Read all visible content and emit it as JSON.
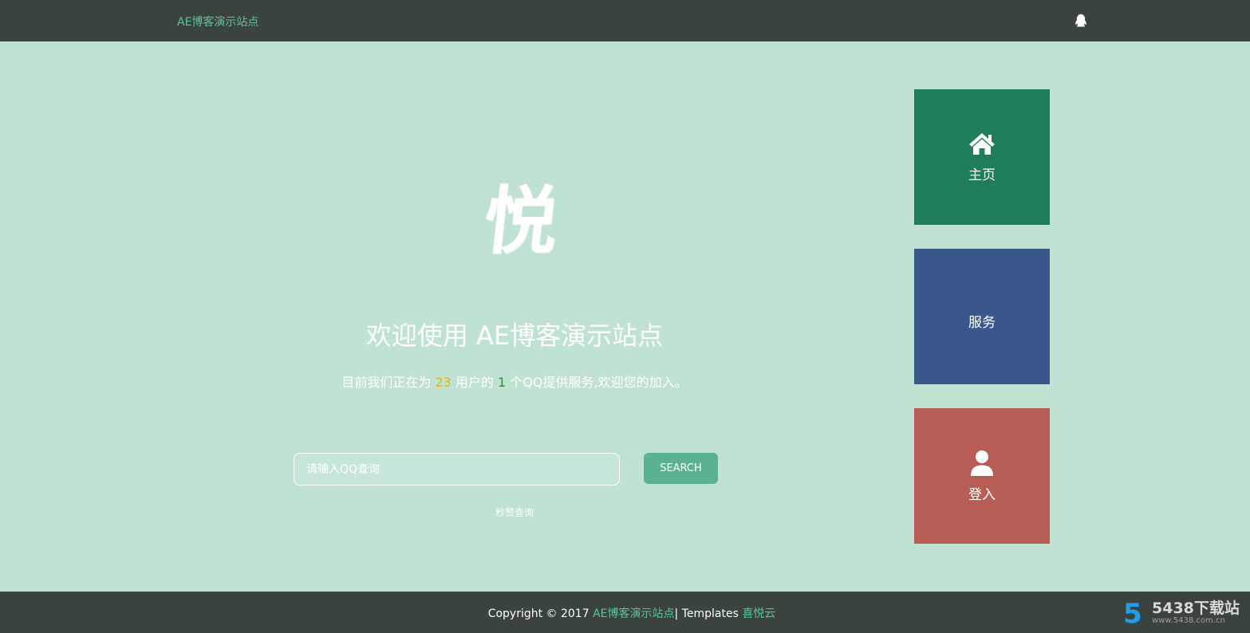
{
  "header": {
    "brand": "AE博客演示站点",
    "qq_icon": "qq-penguin-icon"
  },
  "hero": {
    "logo_char": "悦",
    "welcome_prefix": "欢迎使用 ",
    "welcome_brand_en": "AE",
    "welcome_brand_rest": "博客演示站点",
    "stats_before": "目前我们正在为 ",
    "stats_users": "23",
    "stats_middle": " 用户的 ",
    "stats_qqs": "1",
    "stats_after": " 个QQ提供服务,欢迎您的加入。",
    "search_placeholder": "请输入QQ查询",
    "search_button": "SEARCH",
    "sub_link": "秒赞查询"
  },
  "tiles": [
    {
      "label": "主页",
      "icon": "home-icon",
      "color": "#1f7d57"
    },
    {
      "label": "服务",
      "icon": "",
      "color": "#39578b"
    },
    {
      "label": "登入",
      "icon": "user-icon",
      "color": "#b85d55"
    }
  ],
  "footer": {
    "copyright": "Copyright © 2017 ",
    "site_link": "AE博客演示站点",
    "separator": "| Templates ",
    "template_link": "喜悦云"
  },
  "watermark": {
    "title": "5438下载站",
    "url": "www.5438.com.cn"
  },
  "colors": {
    "background": "#c0e2d3",
    "bars": "#3a433e",
    "accent": "#5ec29a",
    "button": "#5ab38e",
    "users_count": "#e5b02e",
    "qq_count": "#2e8b3a"
  }
}
